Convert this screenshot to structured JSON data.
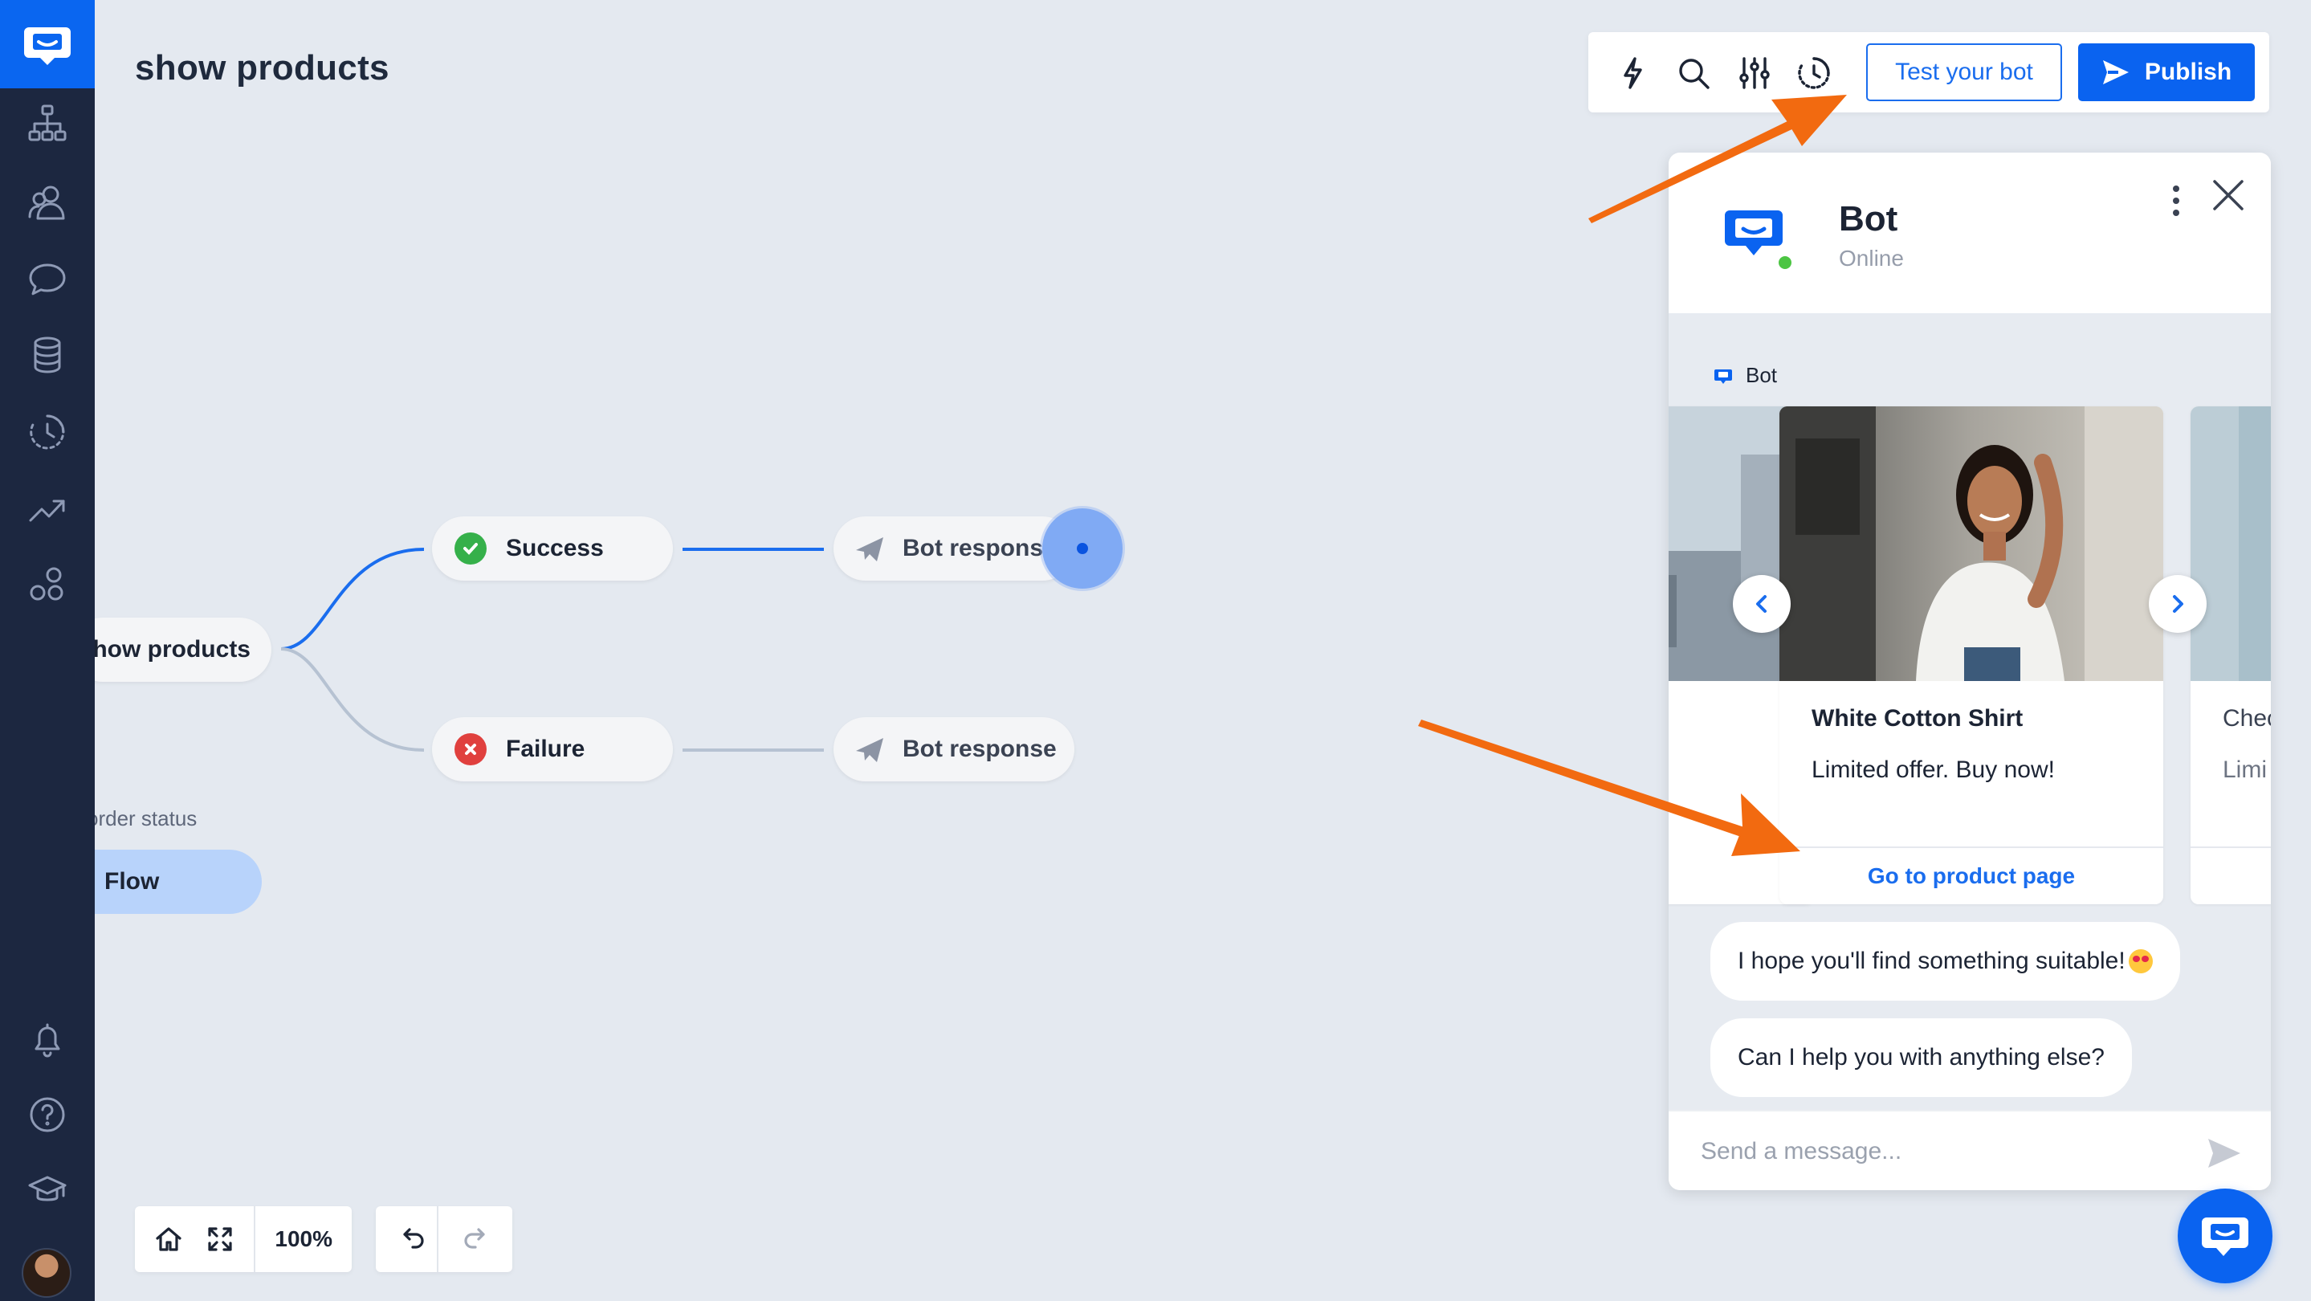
{
  "page": {
    "title": "show products"
  },
  "sidebar": {
    "items": [
      {
        "name": "flows"
      },
      {
        "name": "audience"
      },
      {
        "name": "chats"
      },
      {
        "name": "data"
      },
      {
        "name": "history"
      },
      {
        "name": "reports"
      },
      {
        "name": "integrations"
      }
    ],
    "bottom": [
      {
        "name": "notifications"
      },
      {
        "name": "help"
      },
      {
        "name": "academy"
      }
    ]
  },
  "toolbar": {
    "icons": [
      "lightning-icon",
      "search-icon",
      "sliders-icon",
      "history-icon"
    ],
    "test_label": "Test your bot",
    "publish_label": "Publish"
  },
  "flow": {
    "start_node": "Show products",
    "success_node": "Success",
    "failure_node": "Failure",
    "response_node_1": "Bot response",
    "response_node_2": "Bot response",
    "order_label": "order status",
    "flow_node": "Flow"
  },
  "controls": {
    "zoom": "100%"
  },
  "chat": {
    "bot_name": "Bot",
    "bot_status": "Online",
    "author": "Bot",
    "cards": [
      {
        "title": "",
        "subtitle": "",
        "button": ""
      },
      {
        "title": "White Cotton Shirt",
        "subtitle": "Limited offer. Buy now!",
        "button": "Go to product page"
      },
      {
        "title": "Chec",
        "subtitle": "Limi",
        "button": ""
      }
    ],
    "messages": [
      "I hope you'll find something suitable!",
      "Can I help you with anything else?"
    ],
    "composer_placeholder": "Send a message..."
  },
  "colors": {
    "brand": "#0a63f0",
    "sidebar": "#1c2740",
    "canvas": "#e4e9f0",
    "annotation_arrow": "#f26a10",
    "success": "#35b04a",
    "failure": "#e0403e"
  }
}
